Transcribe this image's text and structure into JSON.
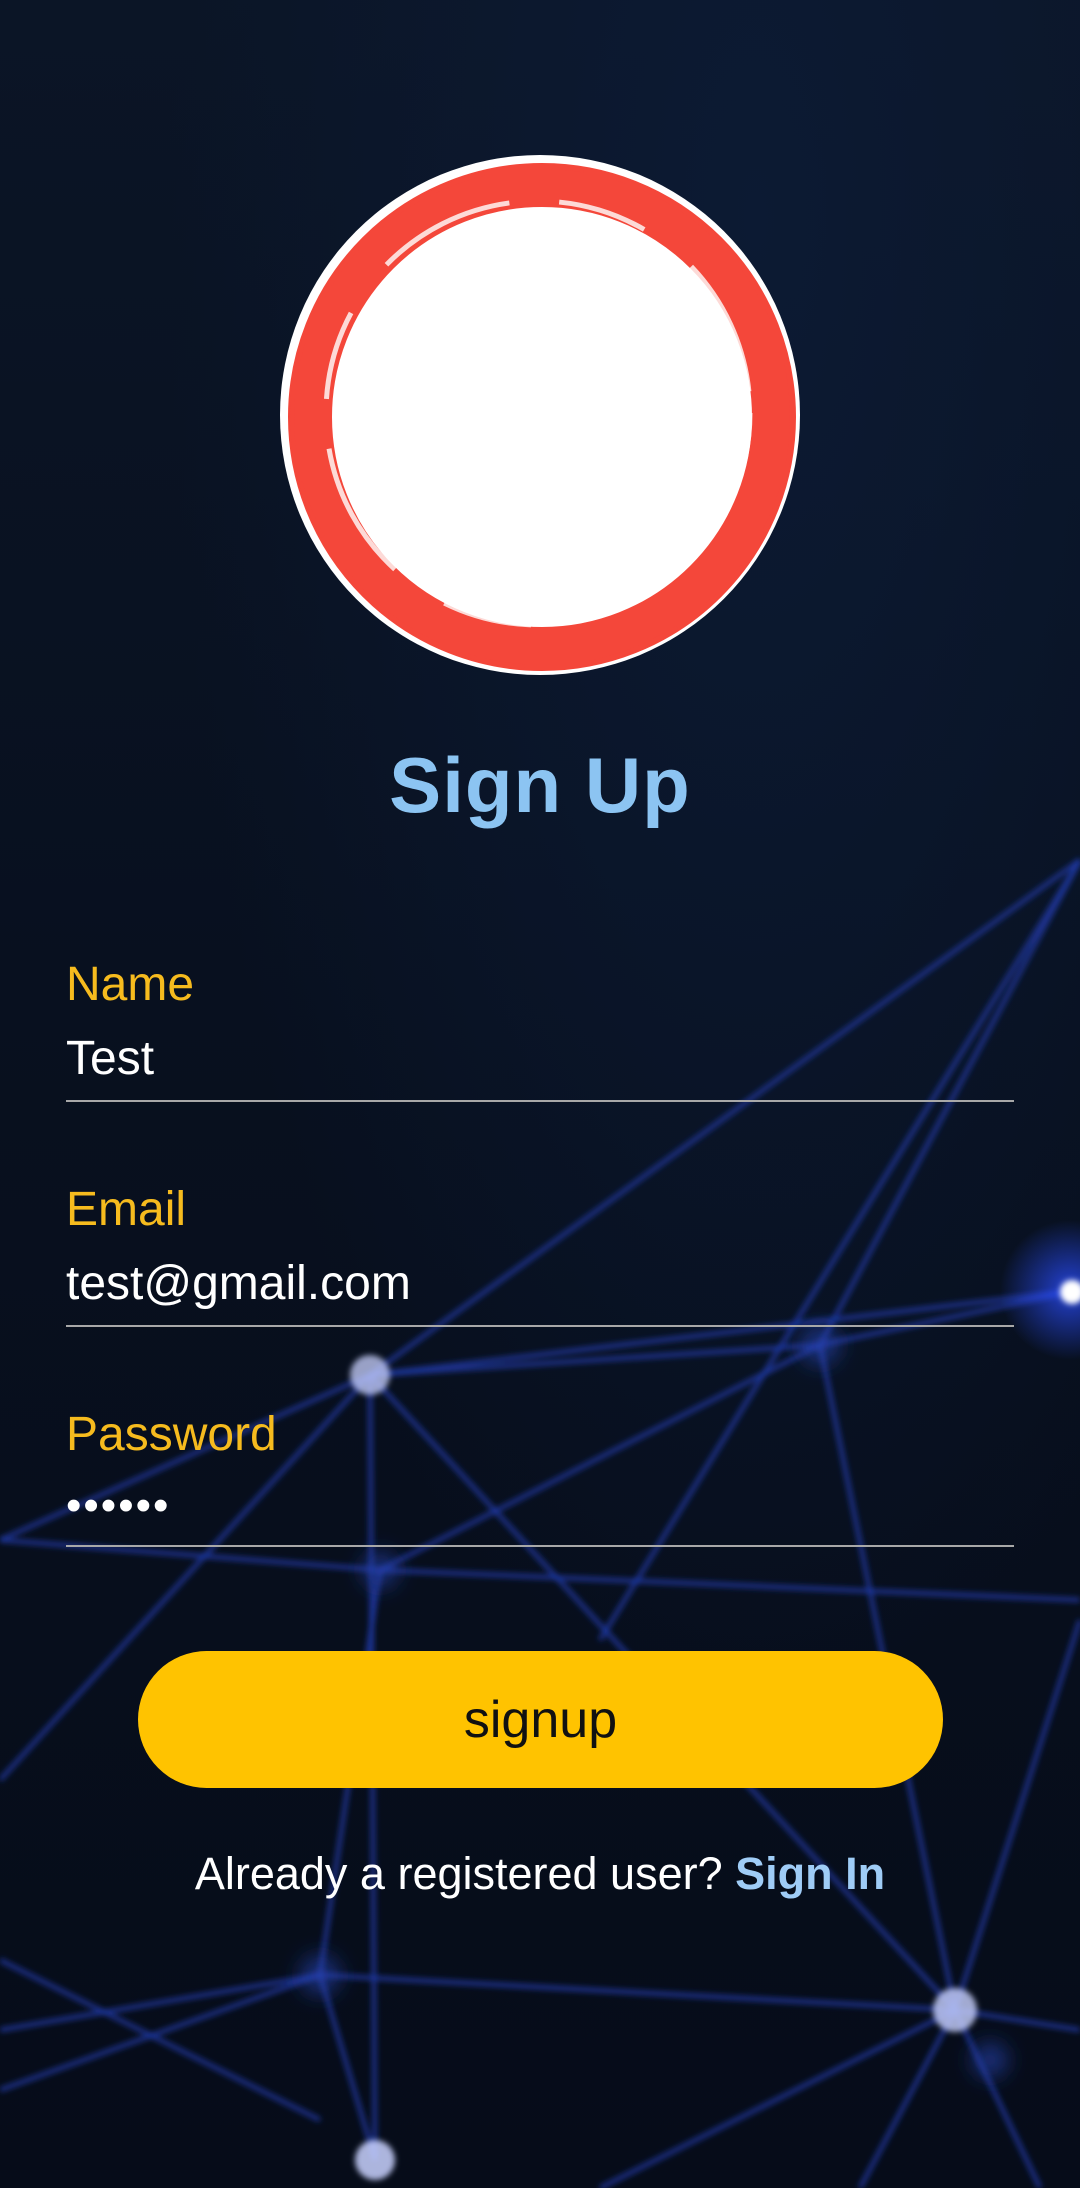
{
  "header": {
    "title": "Sign Up"
  },
  "form": {
    "name": {
      "label": "Name",
      "value": "Test"
    },
    "email": {
      "label": "Email",
      "value": "test@gmail.com"
    },
    "password": {
      "label": "Password",
      "value": "••••••"
    }
  },
  "actions": {
    "signup_label": "signup"
  },
  "footer": {
    "prompt": "Already a registered user?",
    "signin_label": "Sign In"
  },
  "colors": {
    "accent_yellow": "#ffc300",
    "label_yellow": "#f6bb1e",
    "title_blue": "#8cc4f2",
    "link_blue": "#9fccf6",
    "avatar_ring_red": "#f4473a",
    "background": "#070d1b"
  },
  "icons": {
    "avatar": "circle-avatar-icon"
  }
}
